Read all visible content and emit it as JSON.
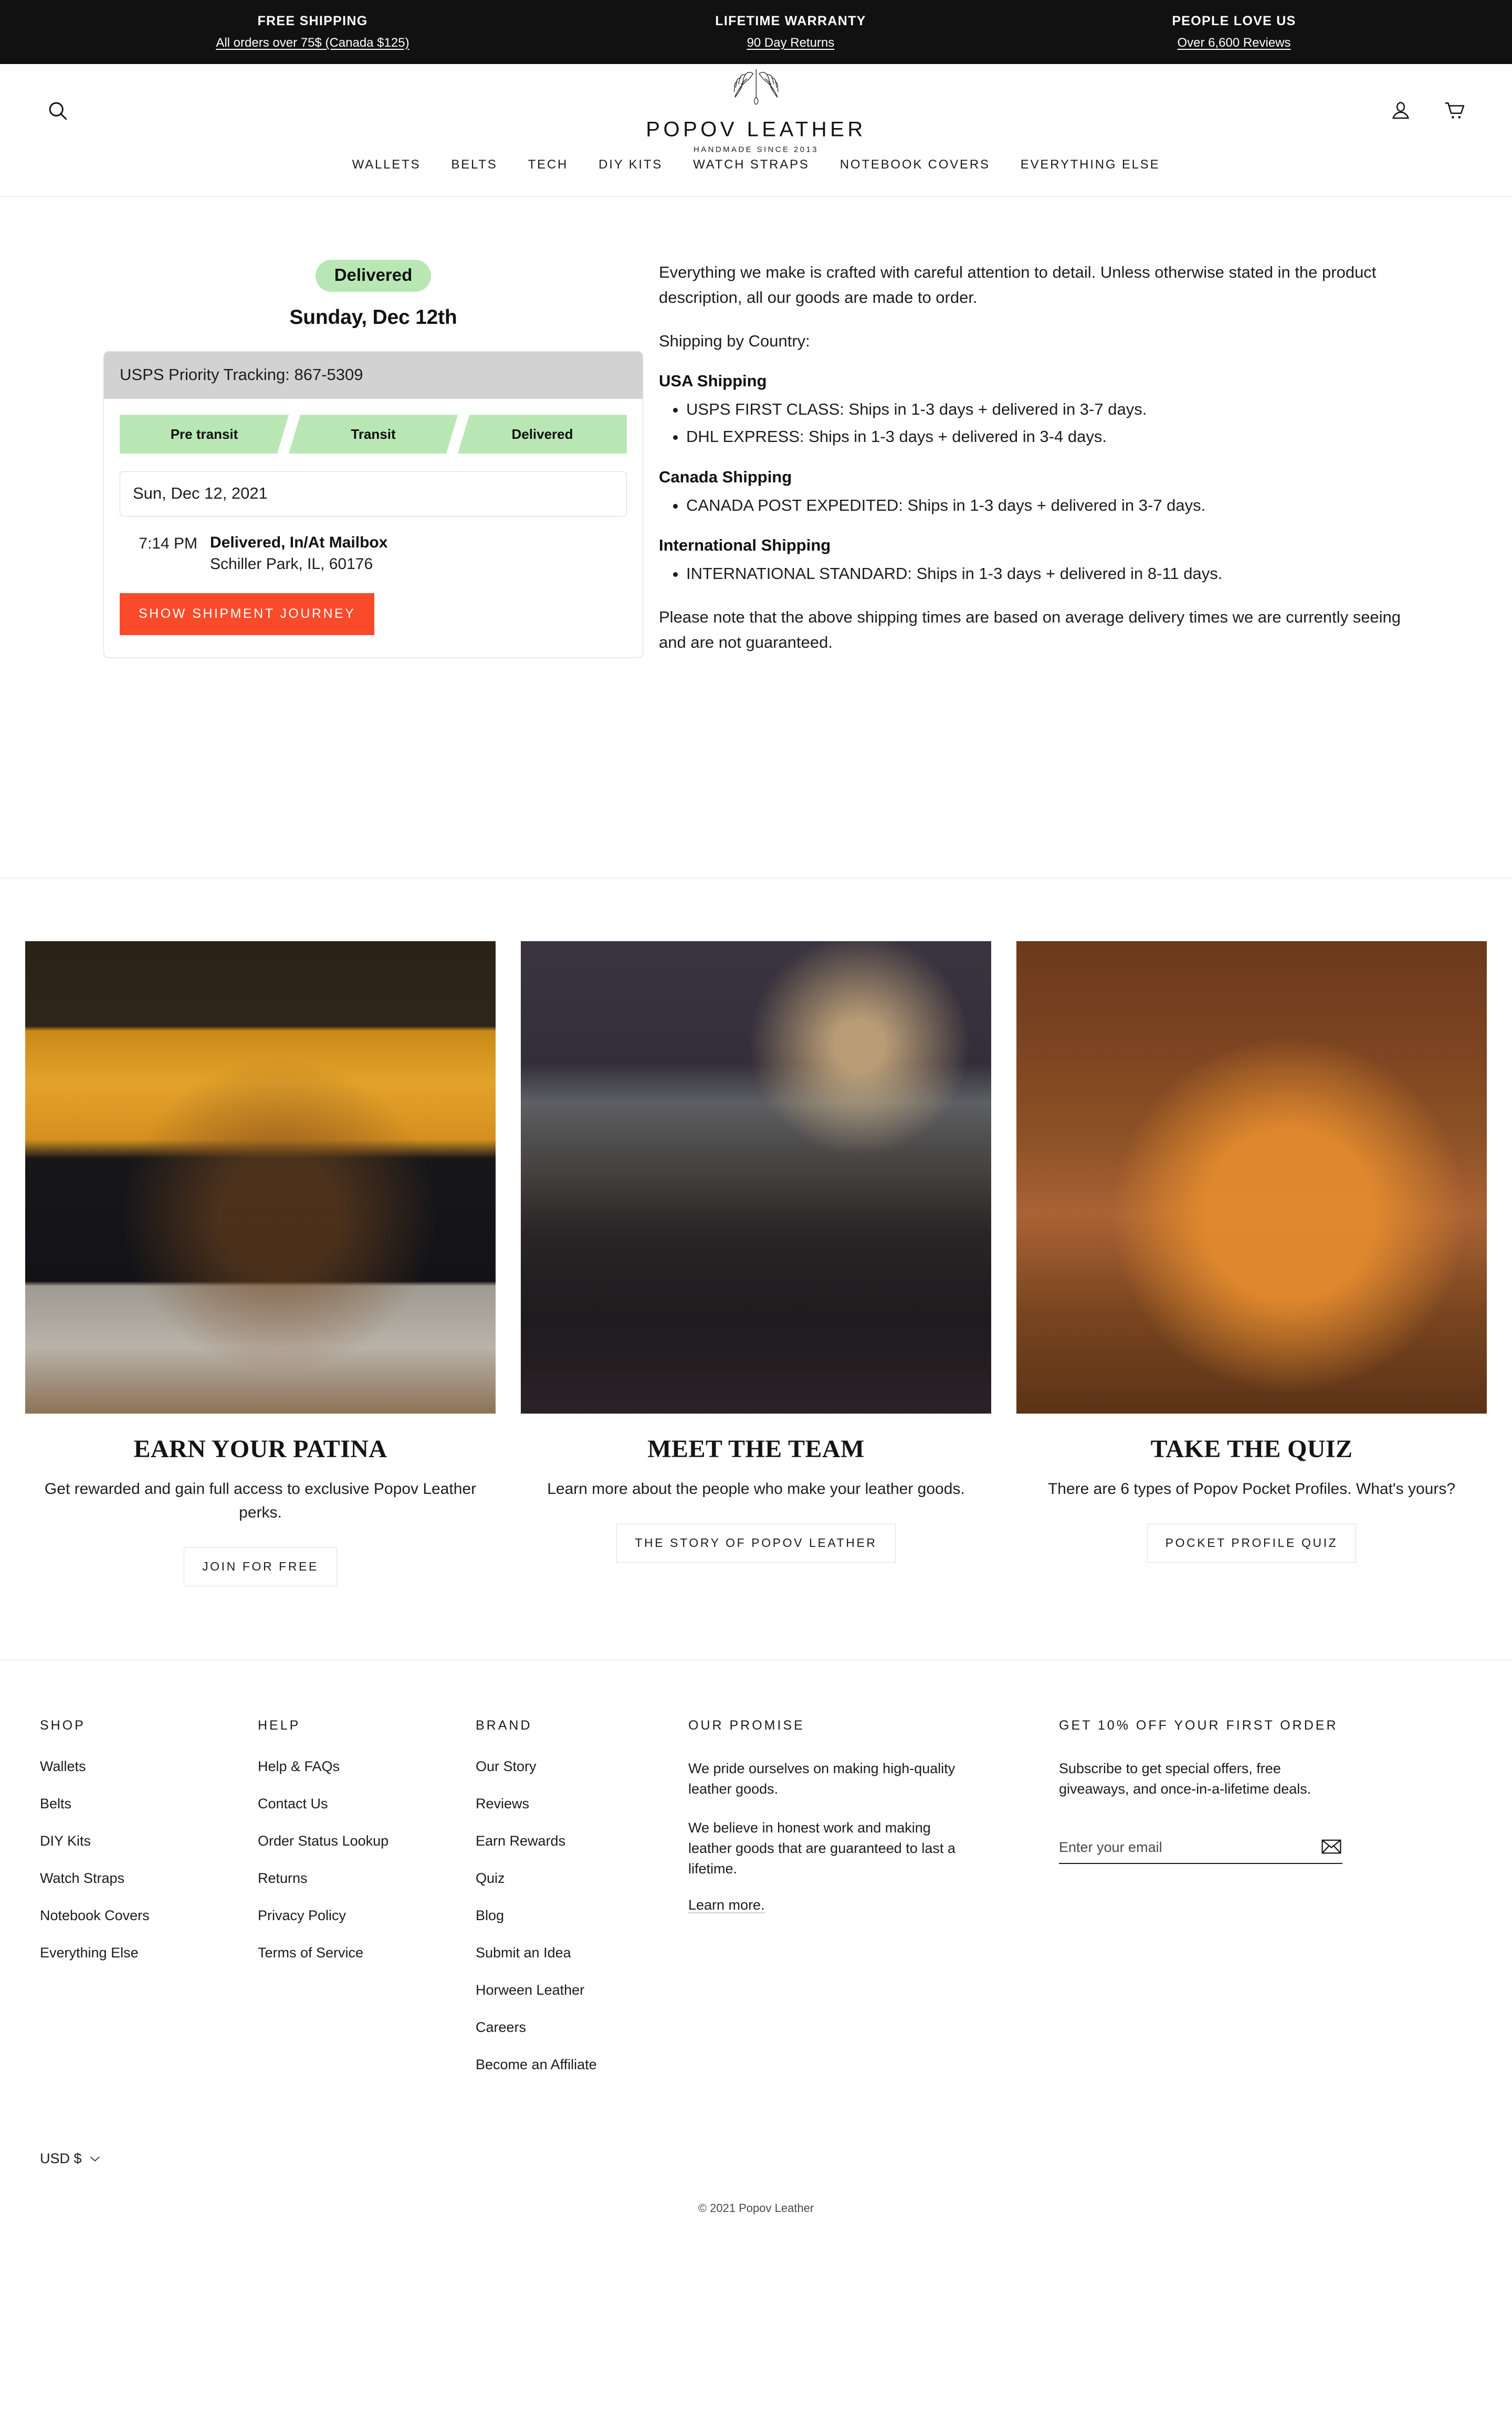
{
  "announcement": {
    "items": [
      {
        "title": "FREE SHIPPING",
        "sub": "All orders over 75$ (Canada $125)"
      },
      {
        "title": "LIFETIME WARRANTY",
        "sub": "90 Day Returns"
      },
      {
        "title": "PEOPLE LOVE US",
        "sub": "Over 6,600 Reviews"
      }
    ]
  },
  "header": {
    "logo_word": "POPOV LEATHER",
    "logo_tagline": "HANDMADE SINCE 2013",
    "search_icon": "search-icon",
    "account_icon": "account-icon",
    "cart_icon": "cart-icon"
  },
  "nav": {
    "items": [
      "WALLETS",
      "BELTS",
      "TECH",
      "DIY KITS",
      "WATCH STRAPS",
      "NOTEBOOK COVERS",
      "EVERYTHING ELSE"
    ]
  },
  "tracking": {
    "status_badge": "Delivered",
    "delivery_date_heading": "Sunday, Dec 12th",
    "card_header": "USPS Priority Tracking: 867-5309",
    "steps": [
      "Pre transit",
      "Transit",
      "Delivered"
    ],
    "date_value": "Sun, Dec 12, 2021",
    "event_time": "7:14 PM",
    "event_title": "Delivered, In/At Mailbox",
    "event_location": "Schiller Park, IL, 60176",
    "journey_button": "Show shipment journey",
    "colors": {
      "badge_green": "#b9e7b4",
      "header_gray": "#d2d2d2",
      "button_orange": "#f94b2a"
    }
  },
  "shipping": {
    "intro": "Everything we make is crafted with careful attention to detail. Unless otherwise stated in the product description, all our goods are made to order.",
    "by_country_label": "Shipping by Country:",
    "groups": [
      {
        "heading": "USA Shipping",
        "items": [
          "USPS FIRST CLASS: Ships in 1-3 days + delivered in 3-7 days.",
          "DHL EXPRESS: Ships in 1-3 days + delivered in 3-4 days."
        ]
      },
      {
        "heading": "Canada Shipping",
        "items": [
          "CANADA POST EXPEDITED: Ships in 1-3 days + delivered in 3-7 days."
        ]
      },
      {
        "heading": "International Shipping",
        "items": [
          "INTERNATIONAL STANDARD: Ships in 1-3 days + delivered in 8-11 days."
        ]
      }
    ],
    "note": "Please note that the above shipping times are based on average delivery times we are currently seeing and are not guaranteed."
  },
  "features": [
    {
      "title": "EARN YOUR PATINA",
      "desc": "Get rewarded and gain full access to exclusive Popov Leather perks.",
      "button": "JOIN FOR FREE",
      "image_alt": "Man in mustard shirt with leather wallet and chain in back pocket"
    },
    {
      "title": "MEET THE TEAM",
      "desc": "Learn more about the people who make your leather goods.",
      "button": "THE STORY OF POPOV LEATHER",
      "image_alt": "Leather workshop with craftspeople at workbenches"
    },
    {
      "title": "TAKE THE QUIZ",
      "desc": "There are 6 types of Popov Pocket Profiles. What's yours?",
      "button": "POCKET PROFILE QUIZ",
      "image_alt": "Person in rust cardigan holding open tan leather wallet"
    }
  ],
  "footer": {
    "shop": {
      "heading": "SHOP",
      "items": [
        "Wallets",
        "Belts",
        "DIY Kits",
        "Watch Straps",
        "Notebook Covers",
        "Everything Else"
      ]
    },
    "help": {
      "heading": "HELP",
      "items": [
        "Help & FAQs",
        "Contact Us",
        "Order Status Lookup",
        "Returns",
        "Privacy Policy",
        "Terms of Service"
      ]
    },
    "brand": {
      "heading": "BRAND",
      "items": [
        "Our Story",
        "Reviews",
        "Earn Rewards",
        "Quiz",
        "Blog",
        "Submit an Idea",
        "Horween Leather",
        "Careers",
        "Become an Affiliate"
      ]
    },
    "promise": {
      "heading": "OUR PROMISE",
      "p1": "We pride ourselves on making high-quality leather goods.",
      "p2": "We believe in honest work and making leather goods that are guaranteed to last a lifetime.",
      "link": "Learn more."
    },
    "newsletter": {
      "heading": "GET 10% OFF YOUR FIRST ORDER",
      "desc": "Subscribe to get special offers, free giveaways, and once-in-a-lifetime deals.",
      "placeholder": "Enter your email",
      "submit_icon": "envelope-icon"
    },
    "currency": "USD $",
    "copyright": "© 2021 Popov Leather"
  }
}
